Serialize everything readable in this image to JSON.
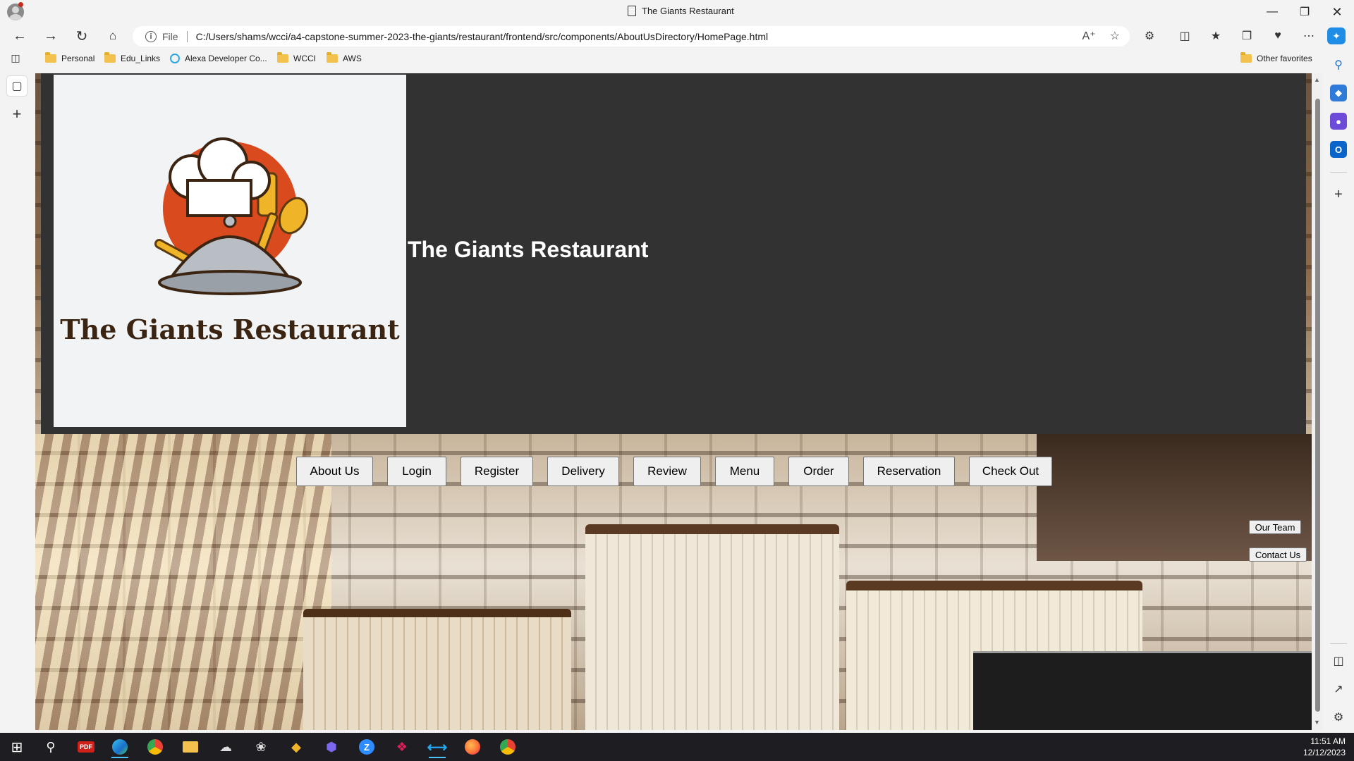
{
  "browser": {
    "tab_title": "The Giants Restaurant",
    "address_prefix": "File",
    "url": "C:/Users/shams/wcci/a4-capstone-summer-2023-the-giants/restaurant/frontend/src/components/AboutUsDirectory/HomePage.html"
  },
  "favorites": [
    {
      "label": "Personal",
      "icon": "folder-icon"
    },
    {
      "label": "Edu_Links",
      "icon": "folder-icon"
    },
    {
      "label": "Alexa Developer Co...",
      "icon": "alexa-icon"
    },
    {
      "label": "WCCI",
      "icon": "folder-icon"
    },
    {
      "label": "AWS",
      "icon": "folder-icon"
    }
  ],
  "other_favorites": "Other favorites",
  "page": {
    "logo_text": "The Giants Restaurant",
    "heading": "The Giants Restaurant",
    "nav": [
      "About Us",
      "Login",
      "Register",
      "Delivery",
      "Review",
      "Menu",
      "Order",
      "Reservation",
      "Check Out"
    ],
    "side_links": [
      "Our Team",
      "Contact Us"
    ]
  },
  "colors": {
    "header_bg": "#323232",
    "logo_bg": "#f1f3f4",
    "logo_text": "#3b2412",
    "accent_red": "#d94a1e",
    "accent_yellow": "#f0b429"
  },
  "taskbar": {
    "time": "11:51 AM",
    "date": "12/12/2023"
  }
}
